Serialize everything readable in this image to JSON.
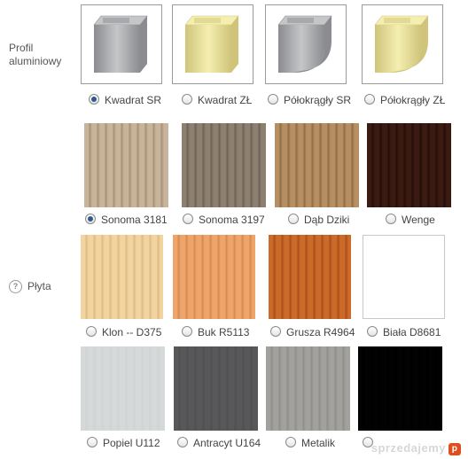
{
  "profile": {
    "label": "Profil aluminiowy",
    "options": [
      {
        "label": "Kwadrat SR",
        "selected": true,
        "finish": "silver",
        "shape": "square"
      },
      {
        "label": "Kwadrat ZŁ",
        "selected": false,
        "finish": "gold",
        "shape": "square"
      },
      {
        "label": "Półokrągły SR",
        "selected": false,
        "finish": "silver",
        "shape": "round"
      },
      {
        "label": "Półokrągły ZŁ",
        "selected": false,
        "finish": "gold",
        "shape": "round"
      }
    ]
  },
  "board": {
    "label": "Płyta",
    "help_icon": "question-mark",
    "options": [
      {
        "label": "Sonoma 3181",
        "selected": true,
        "color": "#c7b49a",
        "grain": "#a48f74"
      },
      {
        "label": "Sonoma 3197",
        "selected": false,
        "color": "#8d8071",
        "grain": "#6b5f53"
      },
      {
        "label": "Dąb Dziki",
        "selected": false,
        "color": "#b68f63",
        "grain": "#8f6a43"
      },
      {
        "label": "Wenge",
        "selected": false,
        "color": "#3b1a12",
        "grain": "#220c08"
      },
      {
        "label": "Klon -- D375",
        "selected": false,
        "color": "#f1d4a0",
        "grain": "#ddb97f"
      },
      {
        "label": "Buk R5113",
        "selected": false,
        "color": "#eea56b",
        "grain": "#d9864b"
      },
      {
        "label": "Grusza R4964",
        "selected": false,
        "color": "#cc6a2a",
        "grain": "#a84d18"
      },
      {
        "label": "Biała D8681",
        "selected": false,
        "color": "#ffffff",
        "grain": "#ffffff"
      },
      {
        "label": "Popiel U112",
        "selected": false,
        "color": "#d5d9da",
        "grain": "#cfd3d4"
      },
      {
        "label": "Antracyt U164",
        "selected": false,
        "color": "#58585a",
        "grain": "#505052"
      },
      {
        "label": "Metalik",
        "selected": false,
        "color": "#a3a19e",
        "grain": "#8f8d8a"
      },
      {
        "label": "",
        "selected": false,
        "color": "#020202",
        "grain": "#000000"
      }
    ]
  },
  "colors": {
    "silver_light": "#c4c6c8",
    "silver_dark": "#8a8c8f",
    "gold_light": "#f4eeb0",
    "gold_dark": "#cfc47a"
  },
  "watermark": "sprzedajemy"
}
